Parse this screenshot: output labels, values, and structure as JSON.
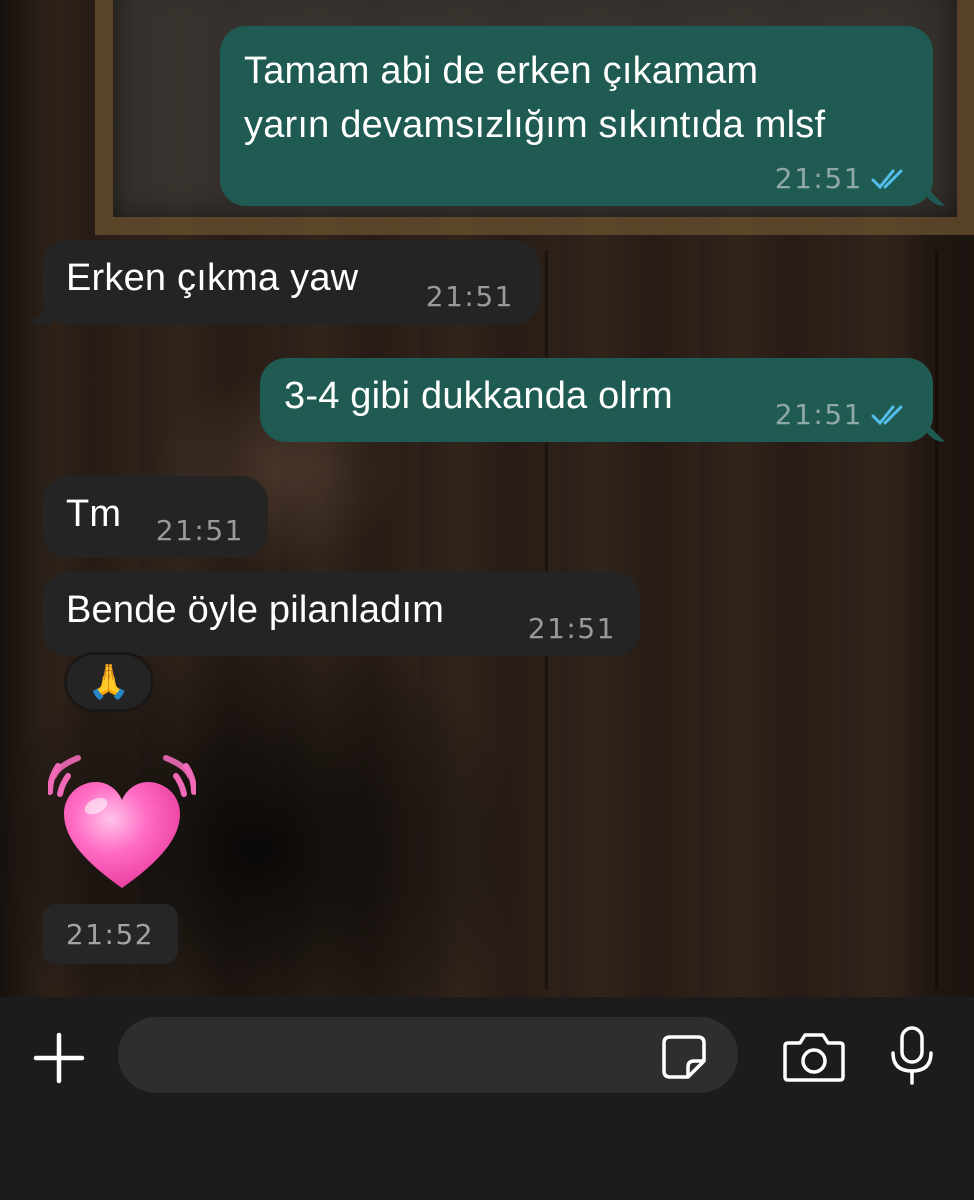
{
  "messages": [
    {
      "direction": "out",
      "lines": [
        "Tamam abi de erken çıkamam",
        "yarın devamsızlığım sıkıntıda mlsf"
      ],
      "time": "21:51",
      "status": "read"
    },
    {
      "direction": "in",
      "text": "Erken çıkma yaw",
      "time": "21:51"
    },
    {
      "direction": "out",
      "text": "3-4 gibi dukkanda olrm",
      "time": "21:51",
      "status": "read"
    },
    {
      "direction": "in",
      "text": "Tm",
      "time": "21:51"
    },
    {
      "direction": "in",
      "text": "Bende öyle pilanladım",
      "time": "21:51",
      "reaction": "🙏"
    },
    {
      "direction": "in",
      "sticker": "beating-heart",
      "time": "21:52"
    }
  ],
  "composer": {
    "placeholder": "",
    "icons": [
      "plus-icon",
      "sticker-icon",
      "camera-icon",
      "microphone-icon"
    ]
  },
  "colors": {
    "outgoing_bubble": "#1f5b52",
    "incoming_bubble": "#242424",
    "read_ticks": "#53bdeb",
    "heart": "#ff5fb8"
  }
}
